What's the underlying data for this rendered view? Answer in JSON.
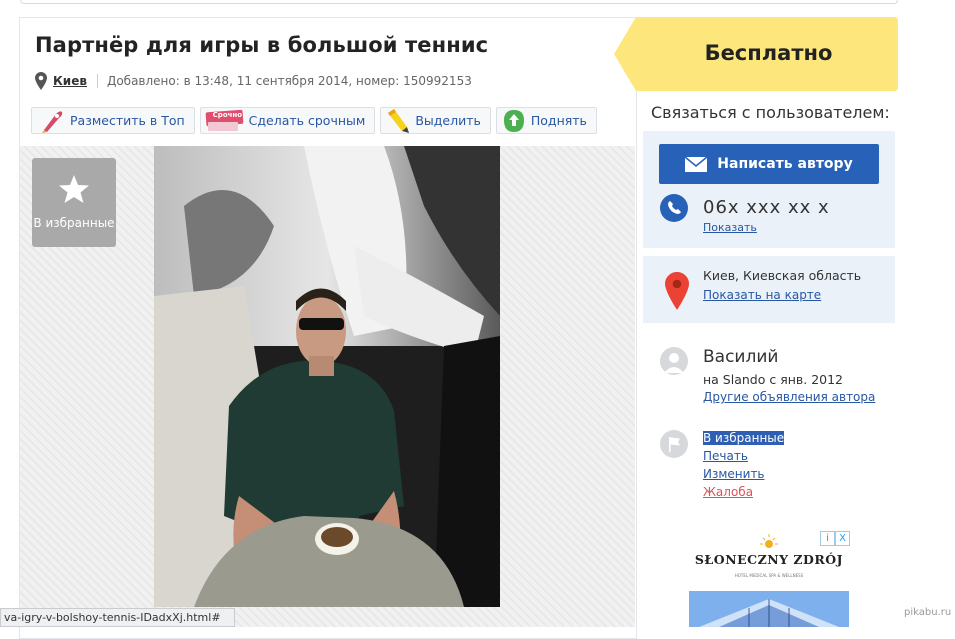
{
  "listing": {
    "title": "Партнёр для игры в большой теннис",
    "city": "Киев",
    "added": "Добавлено: в 13:48, 11 сентября 2014, номер: 150992153"
  },
  "actions": [
    {
      "label": "Разместить в Топ",
      "icon": "rocket-icon"
    },
    {
      "label": "Сделать срочным",
      "icon": "urgent-sticker-icon",
      "badge": "Срочно"
    },
    {
      "label": "Выделить",
      "icon": "highlighter-icon"
    },
    {
      "label": "Поднять",
      "icon": "raise-arrow-icon"
    }
  ],
  "gallery": {
    "favorite_label": "В избранные"
  },
  "price": {
    "label": "Бесплатно"
  },
  "contact": {
    "title": "Связаться с пользователем:",
    "write_button": "Написать автору",
    "phone": "06x xxx xx x",
    "show_phone": "Показать"
  },
  "location": {
    "text": "Киев, Киевская область",
    "map_link": "Показать на карте"
  },
  "user": {
    "name": "Василий",
    "since": "на Slando с янв. 2012",
    "other_ads": "Другие объявления автора"
  },
  "options": {
    "favorite": "В избранные",
    "print": "Печать",
    "edit": "Изменить",
    "complaint": "Жалоба"
  },
  "ad": {
    "brand": "SŁONECZNY ZDRÓJ",
    "tagline": "HOTEL MEDICAL SPA & WELLNESS",
    "info_icon": "i",
    "close_icon": "X"
  },
  "status_bar": {
    "url": "va-igry-v-bolshoy-tennis-IDadxXj.html#"
  },
  "watermark": "pikabu.ru",
  "colors": {
    "accent": "#2862b8",
    "price_bg": "#fde77c",
    "link": "#2857a4",
    "side_box": "#ebf1f8"
  }
}
